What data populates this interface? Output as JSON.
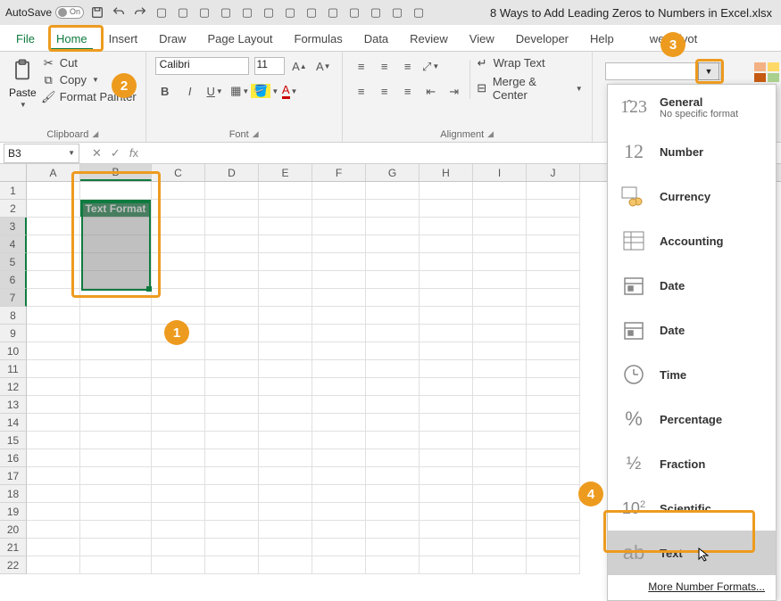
{
  "titlebar": {
    "autosave_label": "AutoSave",
    "autosave_state": "On",
    "filename": "8 Ways to Add Leading Zeros to Numbers in Excel.xlsx"
  },
  "tabs": {
    "file": "File",
    "home": "Home",
    "insert": "Insert",
    "draw": "Draw",
    "page_layout": "Page Layout",
    "formulas": "Formulas",
    "data": "Data",
    "review": "Review",
    "view": "View",
    "developer": "Developer",
    "help": "Help",
    "power_pivot": "wer Pivot"
  },
  "ribbon": {
    "clipboard": {
      "paste": "Paste",
      "cut": "Cut",
      "copy": "Copy",
      "format_painter": "Format Painter",
      "group_label": "Clipboard"
    },
    "font": {
      "name": "Calibri",
      "size": "11",
      "group_label": "Font"
    },
    "alignment": {
      "wrap_text": "Wrap Text",
      "merge_center": "Merge & Center",
      "group_label": "Alignment"
    }
  },
  "formula_bar": {
    "active_cell": "B3",
    "formula": ""
  },
  "sheet": {
    "columns": [
      "A",
      "B",
      "C",
      "D",
      "E",
      "F",
      "G",
      "H",
      "I",
      "J"
    ],
    "visible_rows": 22,
    "b2_text": "Text Format"
  },
  "format_dropdown": {
    "items": [
      {
        "label": "General",
        "sub": "No specific format",
        "icon": "123"
      },
      {
        "label": "Number",
        "icon": "12"
      },
      {
        "label": "Currency",
        "icon": "coins"
      },
      {
        "label": "Accounting",
        "icon": "ledger"
      },
      {
        "label": "Date",
        "icon": "calendar"
      },
      {
        "label": "Date",
        "icon": "calendar"
      },
      {
        "label": "Time",
        "icon": "clock"
      },
      {
        "label": "Percentage",
        "icon": "percent"
      },
      {
        "label": "Fraction",
        "icon": "half"
      },
      {
        "label": "Scientific",
        "icon": "sci"
      },
      {
        "label": "Text",
        "icon": "ab"
      }
    ],
    "footer": "More Number Formats..."
  },
  "callouts": {
    "c1": "1",
    "c2": "2",
    "c3": "3",
    "c4": "4"
  }
}
